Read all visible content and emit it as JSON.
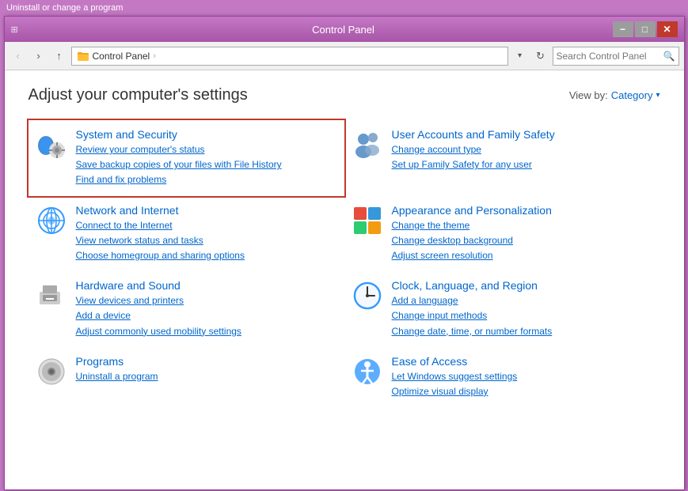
{
  "taskbar": {
    "hint": "Uninstall or change a program"
  },
  "window": {
    "title": "Control Panel",
    "minimize_label": "−",
    "maximize_label": "□",
    "close_label": "✕"
  },
  "address": {
    "back_btn": "‹",
    "forward_btn": "›",
    "up_btn": "↑",
    "path_label": "Control Panel",
    "path_separator": "›",
    "refresh_label": "↻",
    "search_placeholder": "Search Control Panel"
  },
  "content": {
    "title": "Adjust your computer's settings",
    "view_by_label": "View by:",
    "view_by_value": "Category",
    "dropdown_arrow": "▾"
  },
  "categories": [
    {
      "id": "system-security",
      "title": "System and Security",
      "highlighted": true,
      "links": [
        "Review your computer's status",
        "Save backup copies of your files with File History",
        "Find and fix problems"
      ]
    },
    {
      "id": "user-accounts",
      "title": "User Accounts and Family Safety",
      "highlighted": false,
      "links": [
        "Change account type",
        "Set up Family Safety for any user"
      ]
    },
    {
      "id": "network-internet",
      "title": "Network and Internet",
      "highlighted": false,
      "links": [
        "Connect to the Internet",
        "View network status and tasks",
        "Choose homegroup and sharing options"
      ]
    },
    {
      "id": "appearance",
      "title": "Appearance and Personalization",
      "highlighted": false,
      "links": [
        "Change the theme",
        "Change desktop background",
        "Adjust screen resolution"
      ]
    },
    {
      "id": "hardware-sound",
      "title": "Hardware and Sound",
      "highlighted": false,
      "links": [
        "View devices and printers",
        "Add a device",
        "Adjust commonly used mobility settings"
      ]
    },
    {
      "id": "clock-language",
      "title": "Clock, Language, and Region",
      "highlighted": false,
      "links": [
        "Add a language",
        "Change input methods",
        "Change date, time, or number formats"
      ]
    },
    {
      "id": "programs",
      "title": "Programs",
      "highlighted": false,
      "links": [
        "Uninstall a program"
      ]
    },
    {
      "id": "ease-of-access",
      "title": "Ease of Access",
      "highlighted": false,
      "links": [
        "Let Windows suggest settings",
        "Optimize visual display"
      ]
    }
  ]
}
